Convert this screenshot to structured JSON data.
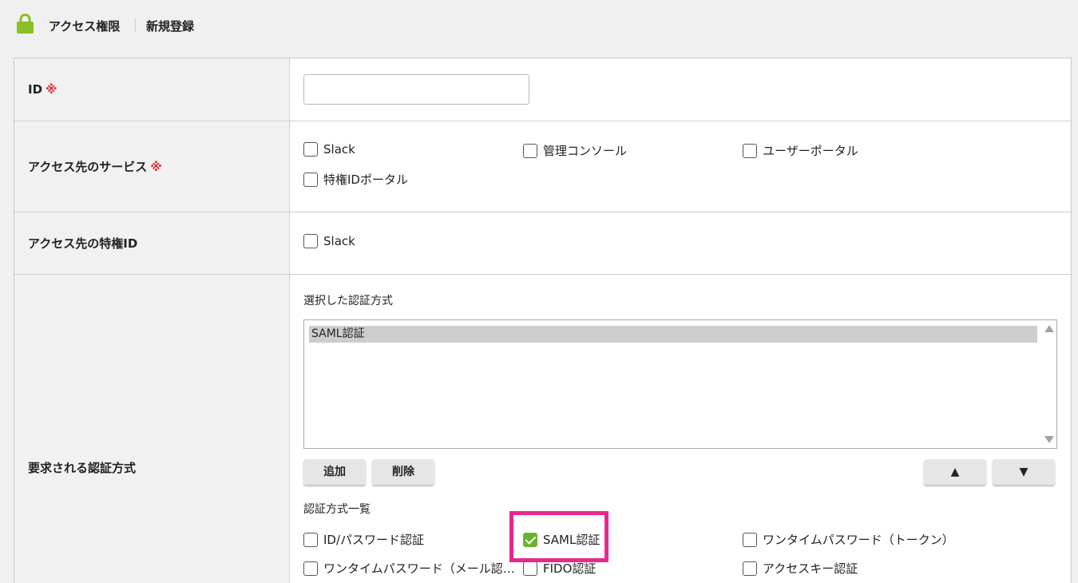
{
  "header": {
    "crumb1": "アクセス権限",
    "crumb2": "新規登録"
  },
  "required_mark": "※",
  "fields": {
    "id_label": "ID",
    "id_value": "",
    "services_label": "アクセス先のサービス",
    "services": [
      {
        "label": "Slack",
        "checked": false
      },
      {
        "label": "管理コンソール",
        "checked": false
      },
      {
        "label": "ユーザーポータル",
        "checked": false
      },
      {
        "label": "特権IDポータル",
        "checked": false
      }
    ],
    "priv_label": "アクセス先の特権ID",
    "priv_ids": [
      {
        "label": "Slack",
        "checked": false
      }
    ],
    "auth_label": "要求される認証方式",
    "selected_title": "選択した認証方式",
    "selected_items": [
      "SAML認証"
    ],
    "add_button": "追加",
    "delete_button": "削除",
    "up_button": "▲",
    "down_button": "▼",
    "list_title": "認証方式一覧",
    "methods": [
      {
        "label": "ID/パスワード認証",
        "checked": false
      },
      {
        "label": "SAML認証",
        "checked": true
      },
      {
        "label": "ワンタイムパスワード（トークン）",
        "checked": false
      },
      {
        "label": "ワンタイムパスワード（メール認…",
        "checked": false
      },
      {
        "label": "FIDO認証",
        "checked": false
      },
      {
        "label": "アクセスキー認証",
        "checked": false
      }
    ]
  },
  "colors": {
    "accent_green": "#6ab42d",
    "required_red": "#dd3333",
    "highlight_pink": "#e8288c"
  }
}
